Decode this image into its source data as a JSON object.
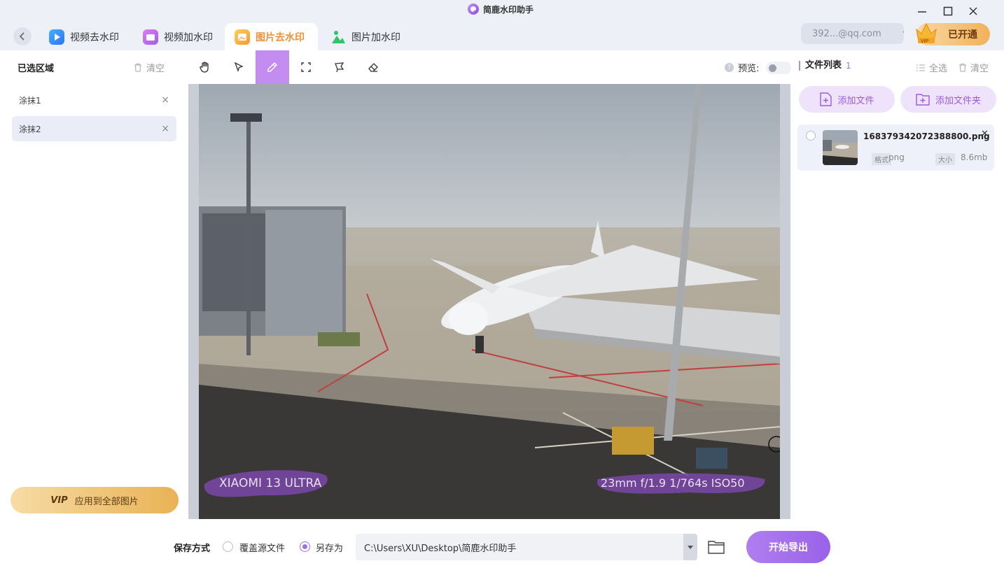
{
  "app": {
    "title": "简鹿水印助手"
  },
  "tabs": [
    {
      "label": "视频去水印"
    },
    {
      "label": "视频加水印"
    },
    {
      "label": "图片去水印"
    },
    {
      "label": "图片加水印"
    }
  ],
  "account": {
    "email": "392...@qq.com",
    "vip_label": "已开通",
    "crown_text": "VIP"
  },
  "left_panel": {
    "title": "已选区域",
    "clear_label": "清空",
    "regions": [
      {
        "label": "涂抹1"
      },
      {
        "label": "涂抹2"
      }
    ],
    "apply_vip": "VIP",
    "apply_label": "应用到全部图片"
  },
  "toolbar": {
    "tools": [
      "hand-icon",
      "pointer-icon",
      "brush-icon",
      "rect-select-icon",
      "lasso-icon",
      "eraser-icon"
    ],
    "active_tool": "brush-icon",
    "preview_label": "预览:",
    "preview_on": false
  },
  "image": {
    "overlay_left": "XIAOMI 13 ULTRA",
    "overlay_right": "23mm  f/1.9  1/764s  ISO50"
  },
  "file_panel": {
    "title": "文件列表",
    "count": "1",
    "select_all": "全选",
    "clear_label": "清空",
    "add_file": "添加文件",
    "add_folder": "添加文件夹",
    "files": [
      {
        "name": "16837934207238880​0.png",
        "format_label": "格式",
        "format": "png",
        "size_label": "大小",
        "size": "8.6mb"
      }
    ]
  },
  "bottom": {
    "save_mode_label": "保存方式",
    "overwrite_label": "覆盖源文件",
    "save_as_label": "另存为",
    "selected": "另存为",
    "path": "C:\\Users\\XU\\Desktop\\简鹿水印助手",
    "export_label": "开始导出"
  },
  "colors": {
    "accent": "#a26ce8",
    "tab_active": "#f0913a",
    "vip_gold": "#f2b15a"
  }
}
